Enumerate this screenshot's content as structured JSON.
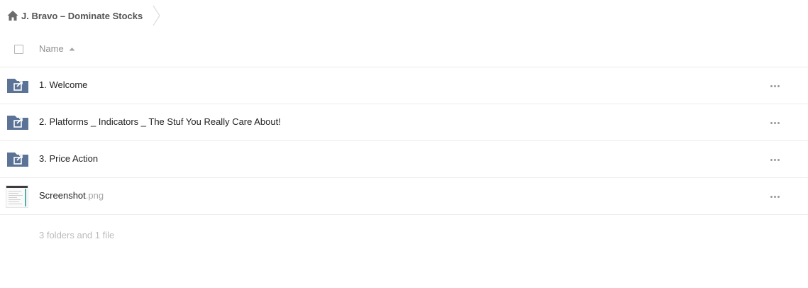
{
  "breadcrumb": {
    "home_icon": "home-icon",
    "label": "J. Bravo – Dominate Stocks"
  },
  "header": {
    "name_label": "Name",
    "sort_icon": "sort-ascending-icon"
  },
  "files": [
    {
      "name": "1. Welcome",
      "ext": "",
      "type": "shared-folder",
      "icon": "shared-folder-icon"
    },
    {
      "name": "2. Platforms _ Indicators _ The Stuf You Really Care About!",
      "ext": "",
      "type": "shared-folder",
      "icon": "shared-folder-icon"
    },
    {
      "name": "3. Price Action",
      "ext": "",
      "type": "shared-folder",
      "icon": "shared-folder-icon"
    },
    {
      "name": "Screenshot",
      "ext": ".png",
      "type": "image",
      "icon": "image-thumbnail"
    }
  ],
  "summary": "3 folders and 1 file",
  "colors": {
    "folder": "#5b7397",
    "text": "#222222",
    "muted": "#8f8f8f",
    "border": "#ececec"
  }
}
